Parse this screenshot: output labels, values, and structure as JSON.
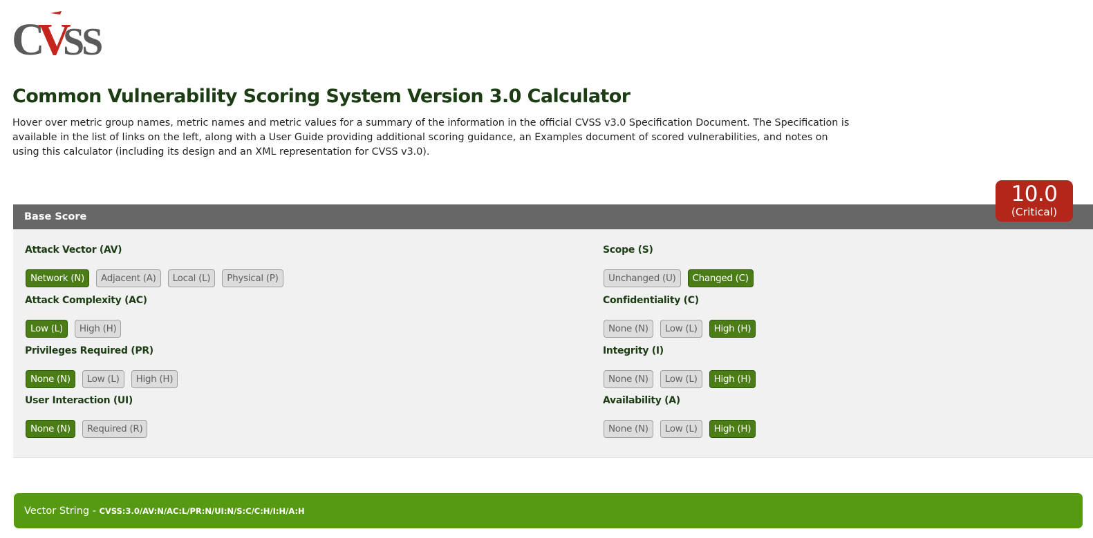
{
  "logo": {
    "text_left": "C",
    "text_v": "V",
    "text_right": "SS"
  },
  "page": {
    "title": "Common Vulnerability Scoring System Version 3.0 Calculator",
    "intro": "Hover over metric group names, metric names and metric values for a summary of the information in the official CVSS v3.0 Specification Document. The Specification is available in the list of links on the left, along with a User Guide providing additional scoring guidance, an Examples document of scored vulnerabilities, and notes on using this calculator (including its design and an XML representation for CVSS v3.0)."
  },
  "score": {
    "value": "10.0",
    "severity": "(Critical)"
  },
  "base": {
    "title": "Base Score",
    "metrics": {
      "av": {
        "title": "Attack Vector (AV)",
        "options": [
          "Network (N)",
          "Adjacent (A)",
          "Local (L)",
          "Physical (P)"
        ],
        "selected": "Network (N)"
      },
      "ac": {
        "title": "Attack Complexity (AC)",
        "options": [
          "Low (L)",
          "High (H)"
        ],
        "selected": "Low (L)"
      },
      "pr": {
        "title": "Privileges Required (PR)",
        "options": [
          "None (N)",
          "Low (L)",
          "High (H)"
        ],
        "selected": "None (N)"
      },
      "ui": {
        "title": "User Interaction (UI)",
        "options": [
          "None (N)",
          "Required (R)"
        ],
        "selected": "None (N)"
      },
      "s": {
        "title": "Scope (S)",
        "options": [
          "Unchanged (U)",
          "Changed (C)"
        ],
        "selected": "Changed (C)"
      },
      "c": {
        "title": "Confidentiality (C)",
        "options": [
          "None (N)",
          "Low (L)",
          "High (H)"
        ],
        "selected": "High (H)"
      },
      "i": {
        "title": "Integrity (I)",
        "options": [
          "None (N)",
          "Low (L)",
          "High (H)"
        ],
        "selected": "High (H)"
      },
      "a": {
        "title": "Availability (A)",
        "options": [
          "None (N)",
          "Low (L)",
          "High (H)"
        ],
        "selected": "High (H)"
      }
    }
  },
  "vector": {
    "label": "Vector String - ",
    "value": "CVSS:3.0/AV:N/AC:L/PR:N/UI:N/S:C/C:H/I:H/A:H"
  },
  "colors": {
    "title_green": "#1c3d14",
    "selected_green": "#4a7d15",
    "vector_green": "#569a13",
    "critical_red": "#b3261a",
    "header_gray": "#676767",
    "logo_gray": "#5a5a5a",
    "logo_red": "#c4261d"
  }
}
